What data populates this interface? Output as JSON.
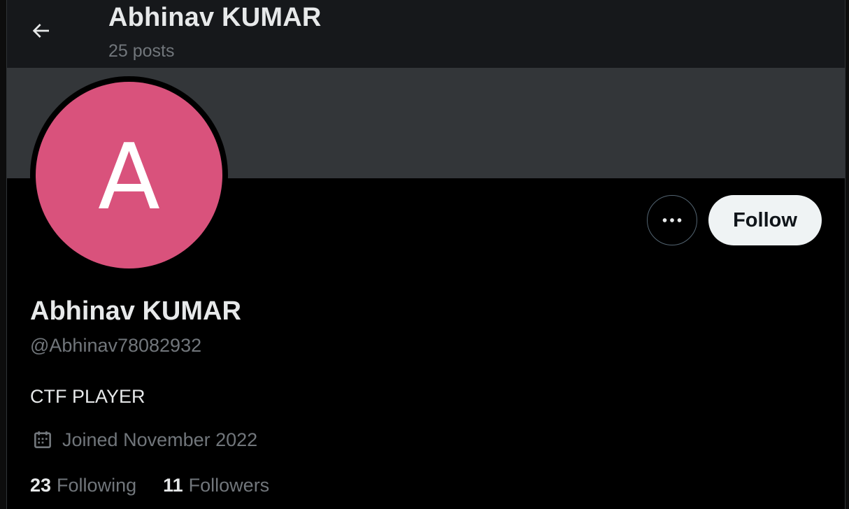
{
  "header": {
    "title": "Abhinav KUMAR",
    "posts_count": "25 posts",
    "back_icon": "arrow-left-icon"
  },
  "profile": {
    "avatar_letter": "A",
    "avatar_color": "#d9527c",
    "banner_color": "#333639",
    "display_name": "Abhinav KUMAR",
    "handle": "@Abhinav78082932",
    "bio": "CTF PLAYER",
    "joined": "Joined November 2022",
    "joined_icon": "calendar-icon"
  },
  "actions": {
    "more_icon": "more-horizontal-icon",
    "follow_label": "Follow"
  },
  "stats": {
    "following_count": "23",
    "following_label": "Following",
    "followers_count": "11",
    "followers_label": "Followers"
  }
}
